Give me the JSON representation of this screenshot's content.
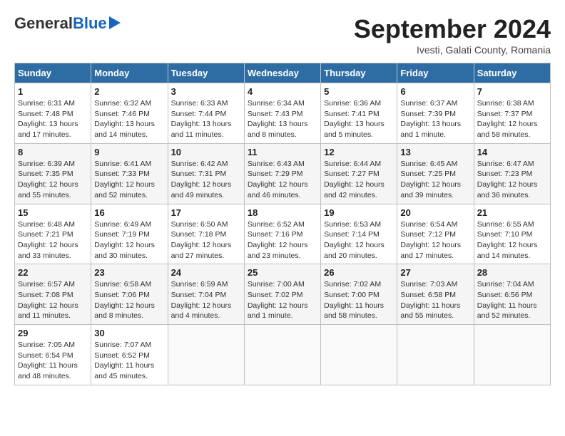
{
  "header": {
    "logo_general": "General",
    "logo_blue": "Blue",
    "month_title": "September 2024",
    "location": "Ivesti, Galati County, Romania"
  },
  "days_of_week": [
    "Sunday",
    "Monday",
    "Tuesday",
    "Wednesday",
    "Thursday",
    "Friday",
    "Saturday"
  ],
  "weeks": [
    [
      {
        "day": "1",
        "sunrise": "Sunrise: 6:31 AM",
        "sunset": "Sunset: 7:48 PM",
        "daylight": "Daylight: 13 hours and 17 minutes."
      },
      {
        "day": "2",
        "sunrise": "Sunrise: 6:32 AM",
        "sunset": "Sunset: 7:46 PM",
        "daylight": "Daylight: 13 hours and 14 minutes."
      },
      {
        "day": "3",
        "sunrise": "Sunrise: 6:33 AM",
        "sunset": "Sunset: 7:44 PM",
        "daylight": "Daylight: 13 hours and 11 minutes."
      },
      {
        "day": "4",
        "sunrise": "Sunrise: 6:34 AM",
        "sunset": "Sunset: 7:43 PM",
        "daylight": "Daylight: 13 hours and 8 minutes."
      },
      {
        "day": "5",
        "sunrise": "Sunrise: 6:36 AM",
        "sunset": "Sunset: 7:41 PM",
        "daylight": "Daylight: 13 hours and 5 minutes."
      },
      {
        "day": "6",
        "sunrise": "Sunrise: 6:37 AM",
        "sunset": "Sunset: 7:39 PM",
        "daylight": "Daylight: 13 hours and 1 minute."
      },
      {
        "day": "7",
        "sunrise": "Sunrise: 6:38 AM",
        "sunset": "Sunset: 7:37 PM",
        "daylight": "Daylight: 12 hours and 58 minutes."
      }
    ],
    [
      {
        "day": "8",
        "sunrise": "Sunrise: 6:39 AM",
        "sunset": "Sunset: 7:35 PM",
        "daylight": "Daylight: 12 hours and 55 minutes."
      },
      {
        "day": "9",
        "sunrise": "Sunrise: 6:41 AM",
        "sunset": "Sunset: 7:33 PM",
        "daylight": "Daylight: 12 hours and 52 minutes."
      },
      {
        "day": "10",
        "sunrise": "Sunrise: 6:42 AM",
        "sunset": "Sunset: 7:31 PM",
        "daylight": "Daylight: 12 hours and 49 minutes."
      },
      {
        "day": "11",
        "sunrise": "Sunrise: 6:43 AM",
        "sunset": "Sunset: 7:29 PM",
        "daylight": "Daylight: 12 hours and 46 minutes."
      },
      {
        "day": "12",
        "sunrise": "Sunrise: 6:44 AM",
        "sunset": "Sunset: 7:27 PM",
        "daylight": "Daylight: 12 hours and 42 minutes."
      },
      {
        "day": "13",
        "sunrise": "Sunrise: 6:45 AM",
        "sunset": "Sunset: 7:25 PM",
        "daylight": "Daylight: 12 hours and 39 minutes."
      },
      {
        "day": "14",
        "sunrise": "Sunrise: 6:47 AM",
        "sunset": "Sunset: 7:23 PM",
        "daylight": "Daylight: 12 hours and 36 minutes."
      }
    ],
    [
      {
        "day": "15",
        "sunrise": "Sunrise: 6:48 AM",
        "sunset": "Sunset: 7:21 PM",
        "daylight": "Daylight: 12 hours and 33 minutes."
      },
      {
        "day": "16",
        "sunrise": "Sunrise: 6:49 AM",
        "sunset": "Sunset: 7:19 PM",
        "daylight": "Daylight: 12 hours and 30 minutes."
      },
      {
        "day": "17",
        "sunrise": "Sunrise: 6:50 AM",
        "sunset": "Sunset: 7:18 PM",
        "daylight": "Daylight: 12 hours and 27 minutes."
      },
      {
        "day": "18",
        "sunrise": "Sunrise: 6:52 AM",
        "sunset": "Sunset: 7:16 PM",
        "daylight": "Daylight: 12 hours and 23 minutes."
      },
      {
        "day": "19",
        "sunrise": "Sunrise: 6:53 AM",
        "sunset": "Sunset: 7:14 PM",
        "daylight": "Daylight: 12 hours and 20 minutes."
      },
      {
        "day": "20",
        "sunrise": "Sunrise: 6:54 AM",
        "sunset": "Sunset: 7:12 PM",
        "daylight": "Daylight: 12 hours and 17 minutes."
      },
      {
        "day": "21",
        "sunrise": "Sunrise: 6:55 AM",
        "sunset": "Sunset: 7:10 PM",
        "daylight": "Daylight: 12 hours and 14 minutes."
      }
    ],
    [
      {
        "day": "22",
        "sunrise": "Sunrise: 6:57 AM",
        "sunset": "Sunset: 7:08 PM",
        "daylight": "Daylight: 12 hours and 11 minutes."
      },
      {
        "day": "23",
        "sunrise": "Sunrise: 6:58 AM",
        "sunset": "Sunset: 7:06 PM",
        "daylight": "Daylight: 12 hours and 8 minutes."
      },
      {
        "day": "24",
        "sunrise": "Sunrise: 6:59 AM",
        "sunset": "Sunset: 7:04 PM",
        "daylight": "Daylight: 12 hours and 4 minutes."
      },
      {
        "day": "25",
        "sunrise": "Sunrise: 7:00 AM",
        "sunset": "Sunset: 7:02 PM",
        "daylight": "Daylight: 12 hours and 1 minute."
      },
      {
        "day": "26",
        "sunrise": "Sunrise: 7:02 AM",
        "sunset": "Sunset: 7:00 PM",
        "daylight": "Daylight: 11 hours and 58 minutes."
      },
      {
        "day": "27",
        "sunrise": "Sunrise: 7:03 AM",
        "sunset": "Sunset: 6:58 PM",
        "daylight": "Daylight: 11 hours and 55 minutes."
      },
      {
        "day": "28",
        "sunrise": "Sunrise: 7:04 AM",
        "sunset": "Sunset: 6:56 PM",
        "daylight": "Daylight: 11 hours and 52 minutes."
      }
    ],
    [
      {
        "day": "29",
        "sunrise": "Sunrise: 7:05 AM",
        "sunset": "Sunset: 6:54 PM",
        "daylight": "Daylight: 11 hours and 48 minutes."
      },
      {
        "day": "30",
        "sunrise": "Sunrise: 7:07 AM",
        "sunset": "Sunset: 6:52 PM",
        "daylight": "Daylight: 11 hours and 45 minutes."
      },
      null,
      null,
      null,
      null,
      null
    ]
  ]
}
